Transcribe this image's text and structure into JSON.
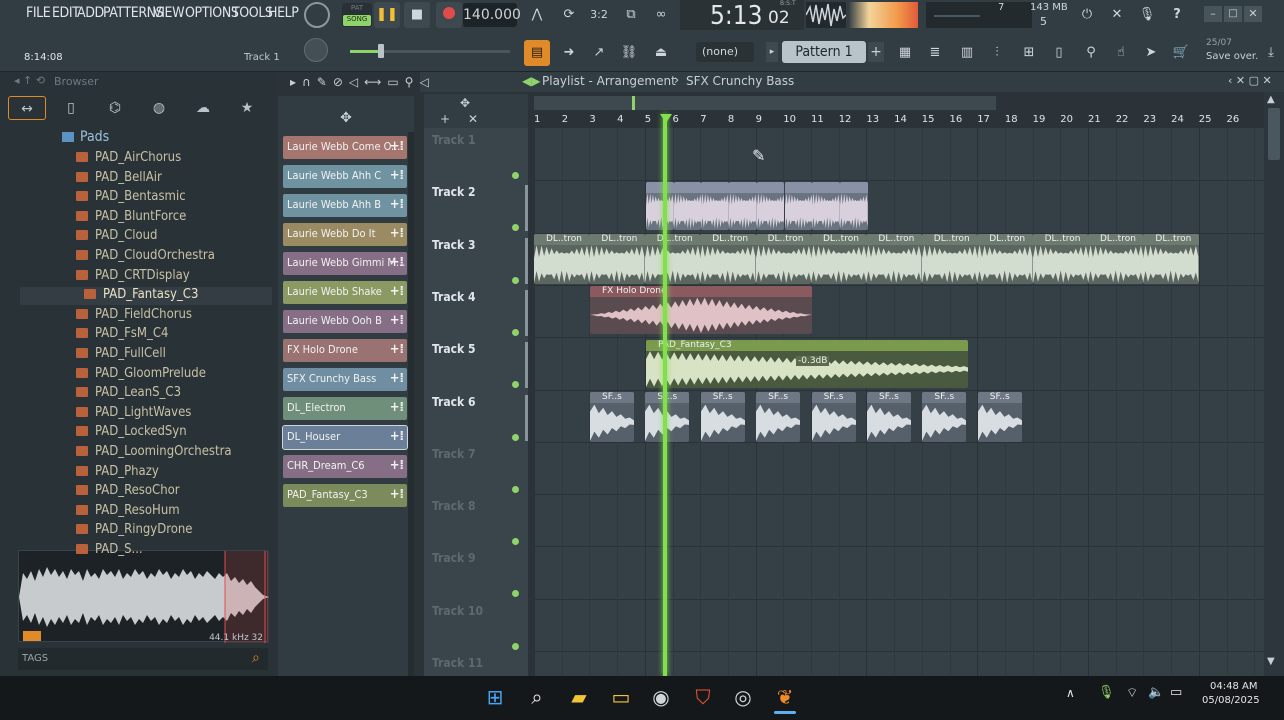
{
  "menu": [
    "FILE",
    "EDIT",
    "ADD",
    "PATTERNS",
    "VIEW",
    "OPTIONS",
    "TOOLS",
    "HELP"
  ],
  "transport": {
    "song_label": "SONG",
    "pat_label": "PAT",
    "tempo": "140.000",
    "time_main": "5:13",
    "time_ticks": "02",
    "time_unit": "B:S:T",
    "cpu_value": "7",
    "mem_value": "143 MB",
    "poly_value": "5"
  },
  "hint_bar": {
    "time": "8:14:08",
    "track": "Track 1"
  },
  "pattern": {
    "none_label": "(none)",
    "name": "Pattern 1",
    "date": "25/07",
    "save_hint": "Save over."
  },
  "browser": {
    "title": "Browser",
    "folder": "Pads",
    "items": [
      "PAD_AirChorus",
      "PAD_BellAir",
      "PAD_Bentasmic",
      "PAD_BluntForce",
      "PAD_Cloud",
      "PAD_CloudOrchestra",
      "PAD_CRTDisplay",
      "PAD_Fantasy_C3",
      "PAD_FieldChorus",
      "PAD_FsM_C4",
      "PAD_FullCell",
      "PAD_GloomPrelude",
      "PAD_LeanS_C3",
      "PAD_LightWaves",
      "PAD_LockedSyn",
      "PAD_LoomingOrchestra",
      "PAD_Phazy",
      "PAD_ResoChor",
      "PAD_ResoHum",
      "PAD_RingyDrone",
      "PAD_S..."
    ],
    "selected_index": 7,
    "wave_info": "44.1 kHz 32",
    "tags_label": "TAGS"
  },
  "channels": [
    {
      "name": "Laurie Webb Come O...",
      "color": "#a5766f"
    },
    {
      "name": "Laurie Webb Ahh C",
      "color": "#6f93a1"
    },
    {
      "name": "Laurie Webb Ahh B",
      "color": "#6f93a1"
    },
    {
      "name": "Laurie Webb Do It",
      "color": "#9a8b63"
    },
    {
      "name": "Laurie Webb Gimmi M...",
      "color": "#866f86"
    },
    {
      "name": "Laurie Webb Shake",
      "color": "#8b9a63"
    },
    {
      "name": "Laurie Webb Ooh B",
      "color": "#866f86"
    },
    {
      "name": "FX Holo Drone",
      "color": "#9a7272"
    },
    {
      "name": "SFX Crunchy Bass",
      "color": "#6f8ea1"
    },
    {
      "name": "DL_Electron",
      "color": "#6f8f7a"
    },
    {
      "name": "DL_Houser",
      "color": "#6b7f99"
    },
    {
      "name": "CHR_Dream_C6",
      "color": "#866f86"
    },
    {
      "name": "PAD_Fantasy_C3",
      "color": "#7b8b5b"
    }
  ],
  "playlist": {
    "title": "Playlist - Arrangement",
    "separator": "›",
    "pattern": "SFX Crunchy Bass",
    "bars": [
      "1",
      "2",
      "3",
      "4",
      "5",
      "6",
      "7",
      "8",
      "9",
      "10",
      "11",
      "12",
      "13",
      "14",
      "15",
      "16",
      "17",
      "18",
      "19",
      "20",
      "21",
      "22",
      "23",
      "24",
      "25",
      "26"
    ],
    "tracks": [
      "Track 1",
      "Track 2",
      "Track 3",
      "Track 4",
      "Track 5",
      "Track 6",
      "Track 7",
      "Track 8",
      "Track 9",
      "Track 10",
      "Track 11"
    ],
    "clips": {
      "t3_label": "DL..tron",
      "t4_label": "FX Holo Drone",
      "t5_label": "PAD_Fantasy_C3",
      "t5_gain": "-0.3dB",
      "t6_label": "SF..s"
    }
  },
  "taskbar": {
    "time": "04:48 AM",
    "date": "05/08/2025"
  },
  "colors": {
    "playhead": "#82e04c",
    "accent_orange": "#e08a2a",
    "led": "#8ed46a"
  }
}
